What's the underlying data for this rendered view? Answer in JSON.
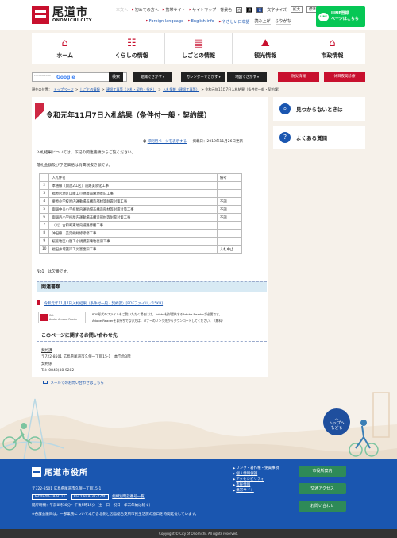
{
  "header": {
    "logo_jp": "尾道市",
    "logo_en": "ONOMICHI CITY",
    "skip_link": "本文へ",
    "util1": [
      "初めての方へ",
      "携帯サイト",
      "サイトマップ"
    ],
    "bg_color_label": "背景色",
    "bg_white": "白",
    "bg_black": "黒",
    "bg_blue": "青",
    "font_size_label": "文字サイズ",
    "font_large": "拡大",
    "font_normal": "標準",
    "lang_en": "Foreign language",
    "lang_en2": "English info",
    "lang_easy": "やさしい日本語",
    "read_aloud": "読み上げ",
    "furigana": "ふりがな",
    "line_badge": "LINE",
    "line_text1": "LINE登録",
    "line_text2": "ページはこちら"
  },
  "nav": [
    {
      "label": "ホーム",
      "icon": "⌂"
    },
    {
      "label": "くらしの情報",
      "icon": "☷"
    },
    {
      "label": "しごとの情報",
      "icon": "▤"
    },
    {
      "label": "観光情報",
      "icon": "⛰"
    },
    {
      "label": "市政情報",
      "icon": "⌂"
    }
  ],
  "search": {
    "enhanced": "ENHANCED BY",
    "google": "Google",
    "button": "検索",
    "org": "組織でさがす",
    "calendar": "カレンダーでさがす",
    "map": "地図でさがす",
    "disaster": "防災情報",
    "holiday": "休日夜間診療"
  },
  "breadcrumb": {
    "current_label": "現在の位置：",
    "items": [
      "トップページ",
      "しごとの情報",
      "建設工事等（入札・契約・指名）",
      "入札情報（建設工事等）"
    ],
    "current": "令和元年11月7日入札結果（条件付一般・契約課）"
  },
  "page": {
    "title": "令和元年11月7日入札結果（条件付一般・契約課）",
    "print_link": "印刷用ページを表示する",
    "posted": "掲載日：2019年11月26日更新",
    "intro": "入札結果については，下記の関連書類からご覧ください。",
    "tax_note": "落札金額及び予定価格は消費税抜き額です。",
    "table_headers": [
      "",
      "入札件名",
      "備考"
    ],
    "rows": [
      {
        "no": "1",
        "name": "",
        "note": ""
      },
      {
        "no": "2",
        "name": "本通線（関連2工区）道路美装化工事",
        "note": ""
      },
      {
        "no": "3",
        "name": "福原尻地区山腹工小規模崩壊地復旧工事",
        "note": ""
      },
      {
        "no": "4",
        "name": "栗原小学校屋内運動場非構造部材等耐震対策工事",
        "note": "不調"
      },
      {
        "no": "5",
        "name": "御調中央小学校屋内運動場非構造部材等耐震対策工事",
        "note": "不調"
      },
      {
        "no": "6",
        "name": "御調西小学校屋内運動場非構造部材等耐震対策工事",
        "note": "不調"
      },
      {
        "no": "7",
        "name": "（災）古和町東地内道路修繕工事",
        "note": ""
      },
      {
        "no": "8",
        "name": "沖田線・美巣線緑修修修工事",
        "note": ""
      },
      {
        "no": "9",
        "name": "桜庭地区山腹工小規模崩壊地復旧工事",
        "note": ""
      },
      {
        "no": "10",
        "name": "福田井堰護岸工災害復旧工事",
        "note": "入札中止"
      }
    ],
    "note_no1": "No1　は欠番です。",
    "related_head": "関連書類",
    "pdf_link": "令和元年11月7日入札結果（条件付一般・契約課）[PDFファイル／15KB]",
    "reader_badge1": "Get",
    "reader_badge2": "Adobe Acrobat Reader",
    "reader_text1": "PDF形式のファイルをご覧いただく場合には，Adobe社が提供するAdobe Readerが必要です。",
    "reader_text2": "Adobe Readerをお持ちでない方は，バナーのリンク先からダウンロードしてください。（無料）",
    "inquiry_head": "このページに関するお問い合わせ先",
    "dept": "契約課",
    "address": "〒722-8501 広島県尾道市久保一丁目15-1　本庁舎3階",
    "dept2": "契約係",
    "tel": "Tel:(0848)38-9282",
    "mail_link": "メールでのお問い合わせはこちら"
  },
  "sidebar": {
    "not_found": "見つからないときは",
    "faq": "よくある質問"
  },
  "to_top": {
    "line1": "トップへ",
    "line2": "もどる"
  },
  "footer": {
    "name": "尾道市役所",
    "address": "〒722-8501 広島県尾道市久保一丁目15-1",
    "tel": "Tel:0848-38-9111",
    "fax": "Fax:0848-37-2740",
    "directory": "組織別電話番号一覧",
    "hours": "開庁時間：午前8時30分～午後5時15分（土・日・祝日・年末年始は除く）",
    "note": "※各課会議日は，一部業務について本庁舎北側と因島総合支所市民生活課の窓口を時間延長しています。",
    "links": [
      "リンク・著作権・免責事項",
      "個人情報保護",
      "アクセシビリティ",
      "市民情報",
      "携帯サイト"
    ],
    "btn1": "市役所案内",
    "btn2": "交通アクセス",
    "btn3": "お問い合わせ",
    "copyright": "Copyright © City of Onomichi. All rights reserved."
  }
}
